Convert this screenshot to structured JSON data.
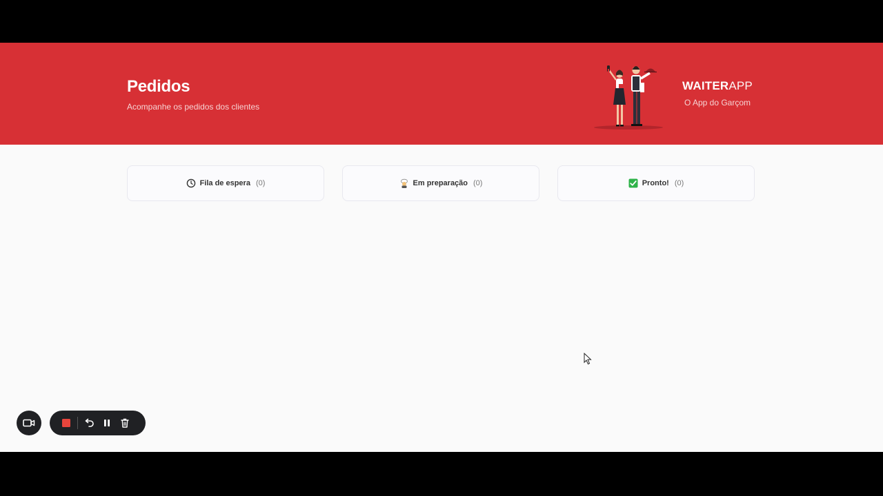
{
  "header": {
    "title": "Pedidos",
    "subtitle": "Acompanhe os pedidos dos clientes",
    "brand_bold": "WAITER",
    "brand_light": "APP",
    "brand_tagline": "O App do Garçom"
  },
  "board": {
    "columns": [
      {
        "icon": "clock-icon",
        "title": "Fila de espera",
        "count": "(0)"
      },
      {
        "icon": "cook-icon",
        "title": "Em preparação",
        "count": "(0)"
      },
      {
        "icon": "check-box-icon",
        "title": "Pronto!",
        "count": "(0)"
      }
    ]
  },
  "recorder": {
    "icons": [
      "video-camera-icon",
      "stop-icon",
      "undo-icon",
      "pause-icon",
      "trash-icon"
    ]
  },
  "colors": {
    "brand": "#d73035",
    "background": "#fafafa",
    "recorder": "#202124",
    "stop": "#e8453c",
    "check": "#2fb34a"
  }
}
